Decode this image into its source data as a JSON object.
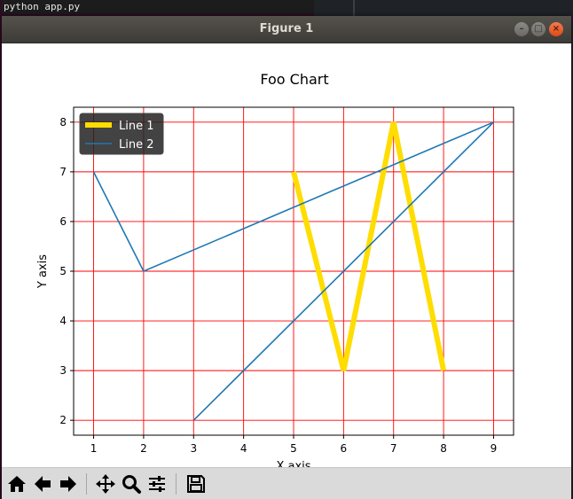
{
  "terminal": {
    "line": "python app.py"
  },
  "window": {
    "title": "Figure 1",
    "controls": {
      "minimize": "–",
      "maximize": "□",
      "close": "×"
    }
  },
  "toolbar": {
    "buttons": [
      {
        "name": "home-icon"
      },
      {
        "name": "back-arrow-icon"
      },
      {
        "name": "forward-arrow-icon"
      },
      {
        "name": "pan-icon"
      },
      {
        "name": "zoom-icon"
      },
      {
        "name": "subplots-config-icon"
      },
      {
        "name": "save-icon"
      }
    ]
  },
  "chart_data": {
    "type": "line",
    "title": "Foo Chart",
    "xlabel": "X axis",
    "ylabel": "Y axis",
    "xlim": [
      0.6,
      9.4
    ],
    "ylim": [
      1.7,
      8.3
    ],
    "xticks": [
      1,
      2,
      3,
      4,
      5,
      6,
      7,
      8,
      9
    ],
    "yticks": [
      2,
      3,
      4,
      5,
      6,
      7,
      8
    ],
    "grid": true,
    "grid_color": "#ff0000",
    "legend_position": "upper-left",
    "series": [
      {
        "name": "Line 1",
        "color": "#ffdd00",
        "x": [
          5,
          6,
          7,
          8
        ],
        "y": [
          7,
          3,
          8,
          3
        ]
      },
      {
        "name": "Line 2",
        "color": "#1f77b4",
        "x": [
          1,
          2,
          9,
          3
        ],
        "y": [
          7,
          5,
          8,
          2
        ]
      }
    ]
  }
}
